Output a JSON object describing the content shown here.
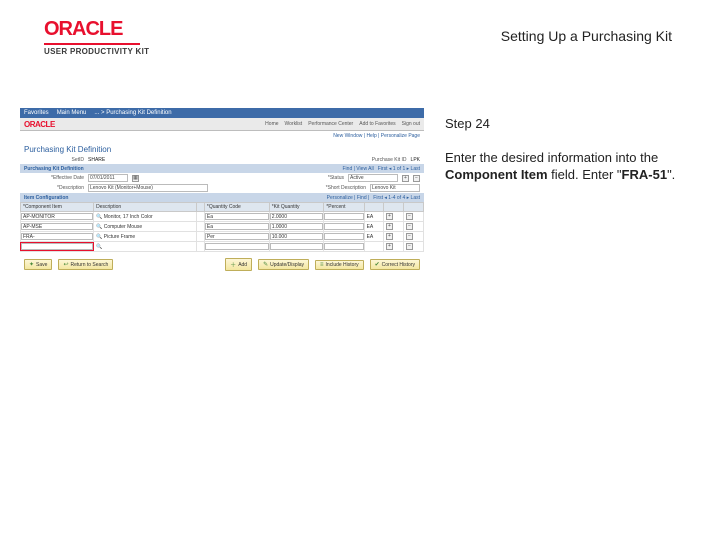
{
  "logo": {
    "brand": "ORACLE",
    "sub": "USER PRODUCTIVITY KIT"
  },
  "page_title": "Setting Up a Purchasing Kit",
  "step": "Step 24",
  "instruction_pre": "Enter the desired information into the ",
  "instruction_bold": "Component Item",
  "instruction_mid": " field. Enter \"",
  "instruction_value": "FRA-51",
  "instruction_post": "\".",
  "app": {
    "titlebar": {
      "favorites": "Favorites",
      "mainmenu": "Main Menu",
      "path": "... > Purchasing Kit Definition"
    },
    "brandbar": {
      "brand": "ORACLE",
      "tabs": [
        "Home",
        "Worklist",
        "Performance Center",
        "Add to Favorites",
        "Sign out"
      ]
    },
    "crumb": "New Window | Help | Personalize Page",
    "section": "Purchasing Kit Definition",
    "fields": {
      "setid_lbl": "SetID",
      "setid_val": "SHARE",
      "pkid_lbl": "Purchase Kit ID",
      "pkid_val": "LPK",
      "effdate_lbl": "*Effective Date",
      "effdate_val": "07/01/2011",
      "status_lbl": "*Status",
      "status_val": "Active",
      "descr_lbl": "*Description",
      "descr_val": "Lenovo Kit (Monitor+Mouse)",
      "short_lbl": "*Short Description",
      "short_val": "Lenovo Kit"
    },
    "strip1": {
      "left": "Purchasing Kit Definition",
      "findlinks": "Find | View All",
      "counter": "First ◂ 1 of 1 ▸ Last"
    },
    "strip2": {
      "left": "Item Configuration",
      "personalize": "Personalize | Find |",
      "counter": "First ◂ 1-4 of 4 ▸ Last"
    },
    "table": {
      "headers": [
        "*Component Item",
        "Description",
        "",
        "*Quantity Code",
        "*Kit Quantity",
        "*Percent",
        "",
        "",
        "",
        ""
      ],
      "rows": [
        {
          "item": "AP-MONITOR",
          "desc": "Monitor, 17 Inch Color",
          "qcode": "Ea",
          "qty": "2.0000",
          "pct": "",
          "uom": "EA"
        },
        {
          "item": "AP-MSE",
          "desc": "Computer Mouse",
          "qcode": "Ea",
          "qty": "1.0000",
          "pct": "",
          "uom": "EA"
        },
        {
          "item": "FRA-",
          "desc": "Picture Frame",
          "qcode": "Per",
          "qty": "10.000",
          "pct": "",
          "uom": "EA"
        },
        {
          "item": "",
          "desc": "",
          "qcode": "",
          "qty": "",
          "pct": "",
          "uom": "",
          "highlight": true
        }
      ]
    },
    "buttons_left": {
      "save": "Save",
      "return": "Return to Search"
    },
    "buttons_right": {
      "add": "Add",
      "update": "Update/Display",
      "include": "Include History",
      "correct": "Correct History"
    }
  }
}
